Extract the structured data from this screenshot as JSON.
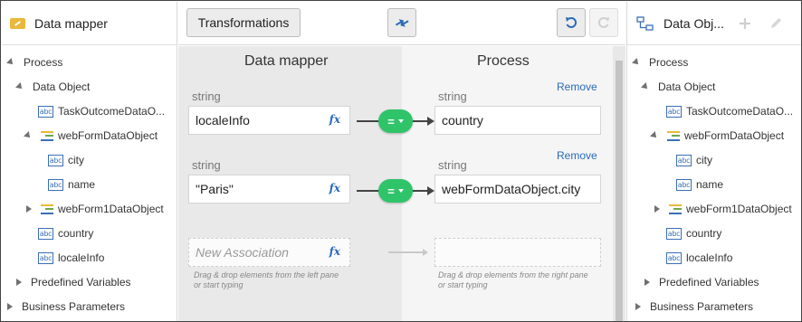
{
  "left_panel": {
    "title": "Data mapper",
    "tree": [
      {
        "label": "Process",
        "kind": "expanded"
      },
      {
        "label": "Data Object",
        "kind": "expanded"
      },
      {
        "label": "TaskOutcomeDataO...",
        "kind": "string"
      },
      {
        "label": "webFormDataObject",
        "kind": "object-expanded"
      },
      {
        "label": "city",
        "kind": "string"
      },
      {
        "label": "name",
        "kind": "string"
      },
      {
        "label": "webForm1DataObject",
        "kind": "object-collapsed"
      },
      {
        "label": "country",
        "kind": "string"
      },
      {
        "label": "localeInfo",
        "kind": "string"
      },
      {
        "label": "Predefined Variables",
        "kind": "collapsed"
      },
      {
        "label": "Business Parameters",
        "kind": "collapsed"
      }
    ]
  },
  "toolbar": {
    "transformations_label": "Transformations",
    "swap_icon": "swap-arrows-icon",
    "undo_icon": "undo-icon",
    "redo_icon": "redo-icon",
    "accent": "#2b6bb5"
  },
  "mapper": {
    "left_title": "Data mapper",
    "right_title": "Process",
    "rows": [
      {
        "source_type": "string",
        "source_value": "localeInfo",
        "target_type": "string",
        "target_value": "country",
        "remove_label": "Remove",
        "operator": "="
      },
      {
        "source_type": "string",
        "source_value": "\"Paris\"",
        "target_type": "string",
        "target_value": "webFormDataObject.city",
        "remove_label": "Remove",
        "operator": "="
      }
    ],
    "fx_label": "fx",
    "new_association_placeholder": "New Association",
    "left_hint": "Drag & drop elements from the left pane or start typing",
    "right_hint": "Drag & drop elements from the right pane or start typing",
    "pill_color": "#2fc46a"
  },
  "right_panel": {
    "title": "Data Obj...",
    "tree": [
      {
        "label": "Process",
        "kind": "expanded"
      },
      {
        "label": "Data Object",
        "kind": "expanded"
      },
      {
        "label": "TaskOutcomeDataO...",
        "kind": "string"
      },
      {
        "label": "webFormDataObject",
        "kind": "object-expanded"
      },
      {
        "label": "city",
        "kind": "string"
      },
      {
        "label": "name",
        "kind": "string"
      },
      {
        "label": "webForm1DataObject",
        "kind": "object-collapsed"
      },
      {
        "label": "country",
        "kind": "string"
      },
      {
        "label": "localeInfo",
        "kind": "string"
      },
      {
        "label": "Predefined Variables",
        "kind": "collapsed"
      },
      {
        "label": "Business Parameters",
        "kind": "collapsed"
      }
    ]
  }
}
